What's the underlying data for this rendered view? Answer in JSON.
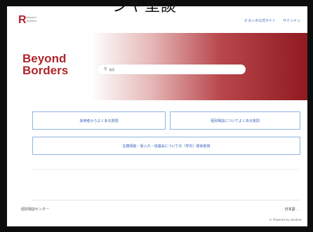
{
  "top_cut_text": "ンヤ室談",
  "header": {
    "logo_mark": "R",
    "logo_sub": "Beyond Borders",
    "nav": [
      {
        "label": "ビヨンボ公式サイト"
      },
      {
        "label": "サインイン"
      }
    ]
  },
  "hero": {
    "brand_title": "Beyond Borders",
    "search": {
      "placeholder": "検索"
    }
  },
  "faq": {
    "card_1": "採用者からよくある質問",
    "card_2": "個別相談についてよくある質問",
    "card_3": "在籍相談・受入れ・協議会についての（学内）関係者用"
  },
  "footer": {
    "left_text": "個別相談センター",
    "language": "日本語",
    "powered_by": "Powered by zendesk"
  },
  "colors": {
    "brand_red": "#b0252b",
    "link_blue": "#3a64b8",
    "card_border": "#8fb3e6"
  }
}
